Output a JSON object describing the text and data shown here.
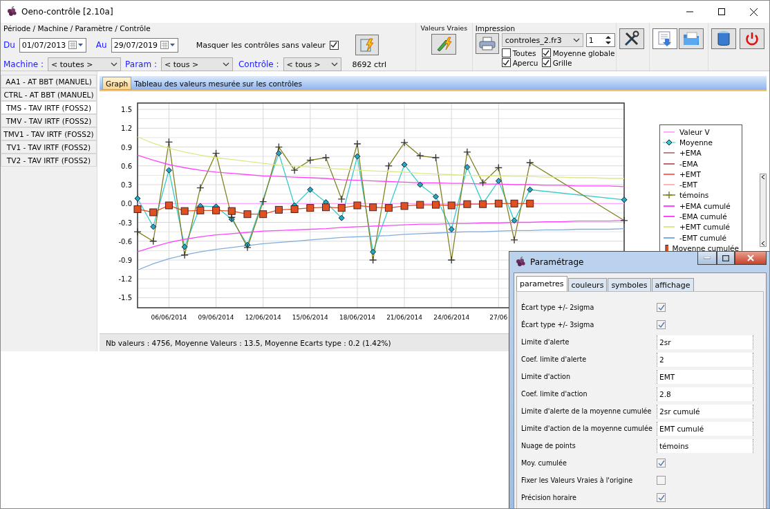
{
  "window": {
    "title": "Oeno-contrôle [2.10a]"
  },
  "filter_group": {
    "title": "Période / Machine / Paramètre / Contrôle",
    "from_label": "Du",
    "from_date": "01/07/2013",
    "to_label": "Au",
    "to_date": "29/07/2019",
    "hide_empty_label": "Masquer les contrôles sans valeur",
    "hide_empty_checked": true,
    "machine_label": "Machine :",
    "machine_value": "< toutes >",
    "param_label": "Param :",
    "param_value": "< tous >",
    "control_label": "Contrôle :",
    "control_value": "< tous >",
    "count": "8692 ctrl"
  },
  "true_values": {
    "title": "Valeurs Vraies"
  },
  "printing": {
    "title": "Impression",
    "template": "controles_2.fr3",
    "copies": "1",
    "options": [
      {
        "label": "Toutes",
        "checked": false
      },
      {
        "label": "Moyenne globale",
        "checked": true
      },
      {
        "label": "Apercu",
        "checked": true
      },
      {
        "label": "Grille",
        "checked": true
      }
    ]
  },
  "sidebar": {
    "items": [
      {
        "label": "AA1 - AT BBT (MANUEL)",
        "selected": false
      },
      {
        "label": "CTRL - AT BBT (MANUEL)",
        "selected": false
      },
      {
        "label": "TMS - TAV IRTF (FOSS2)",
        "selected": true
      },
      {
        "label": "TMV - TAV IRTF (FOSS2)",
        "selected": false
      },
      {
        "label": "TMV1 - TAV IRTF (FOSS2)",
        "selected": false
      },
      {
        "label": "TV1 - TAV IRTF (FOSS2)",
        "selected": false
      },
      {
        "label": "TV2 - TAV IRTF (FOSS2)",
        "selected": false
      }
    ]
  },
  "tabs": [
    {
      "label": "Graph",
      "selected": true
    },
    {
      "label": "Tableau des valeurs mesurée sur les contrôles",
      "selected": false
    }
  ],
  "chart": {
    "chart_data": {
      "type": "line",
      "grid": true,
      "categories": [
        null,
        null,
        "06/06/2014",
        null,
        null,
        "09/06/2014",
        null,
        null,
        "12/06/2014",
        null,
        null,
        "15/06/2014",
        null,
        null,
        "18/06/2014",
        null,
        null,
        "21/06/2014",
        null,
        null,
        "24/06/2014",
        null,
        null,
        "27/06",
        null,
        null,
        null,
        null,
        null,
        null,
        null,
        null
      ],
      "ylim": [
        -1.66,
        1.6
      ],
      "yticks": [
        {
          "value": 1.5,
          "label": "1.5"
        },
        {
          "value": 1.2,
          "label": "1.2"
        },
        {
          "value": 0.9,
          "label": "0.9"
        },
        {
          "value": 0.6,
          "label": "0.6"
        },
        {
          "value": 0.3,
          "label": "0.3"
        },
        {
          "value": 0,
          "label": "0.0"
        },
        {
          "value": -0.3,
          "label": "-0.3"
        },
        {
          "value": -0.6,
          "label": "-0.6"
        },
        {
          "value": -0.9,
          "label": "-0.9"
        },
        {
          "value": -1.2,
          "label": "-1.2"
        },
        {
          "value": -1.5,
          "label": "-1.5"
        }
      ],
      "series": [
        {
          "name": "Valeur V",
          "color": "#ffaaff",
          "marker": "none",
          "values": [
            0,
            0,
            0,
            0,
            0,
            0,
            0,
            0,
            0,
            0,
            0,
            0,
            0,
            0,
            0,
            0,
            0,
            0,
            0,
            0,
            0,
            0,
            0,
            0,
            0,
            0,
            0,
            0,
            0,
            0,
            0,
            0
          ]
        },
        {
          "name": "Moyenne",
          "color": "#33cccc",
          "marker": "diamond",
          "values": [
            0.08,
            -0.37,
            0.53,
            -0.69,
            -0.04,
            -0.05,
            -0.25,
            -0.66,
            null,
            0.8,
            -0.03,
            0.22,
            0.02,
            -0.23,
            0.75,
            -0.77,
            null,
            0.62,
            0.3,
            0.11,
            -0.41,
            0.58,
            0.0,
            0.36,
            -0.27,
            0.22,
            null,
            null,
            null,
            null,
            null,
            0.06
          ]
        },
        {
          "name": "+EMA",
          "color": "#b08888",
          "marker": "none",
          "values": [
            null,
            null,
            null,
            null,
            null,
            null,
            null,
            null,
            null,
            null,
            null,
            null,
            null,
            null,
            null,
            null,
            null,
            null,
            null,
            null,
            null,
            null,
            null,
            null,
            null,
            null,
            null,
            null,
            null,
            null,
            null,
            null
          ]
        },
        {
          "name": "-EMA",
          "color": "#c06868",
          "marker": "none",
          "values": [
            null,
            null,
            null,
            null,
            null,
            null,
            null,
            null,
            null,
            null,
            null,
            null,
            null,
            null,
            null,
            null,
            null,
            null,
            null,
            null,
            null,
            null,
            null,
            null,
            null,
            null,
            null,
            null,
            null,
            null,
            null,
            null
          ]
        },
        {
          "name": "+EMT",
          "color": "#ff6666",
          "marker": "none",
          "values": [
            null,
            null,
            null,
            null,
            null,
            null,
            null,
            null,
            null,
            null,
            null,
            null,
            null,
            null,
            null,
            null,
            null,
            null,
            null,
            null,
            null,
            null,
            null,
            null,
            null,
            null,
            null,
            null,
            null,
            null,
            null,
            null
          ]
        },
        {
          "name": "-EMT",
          "color": "#ffb4b4",
          "marker": "none",
          "values": [
            null,
            null,
            null,
            null,
            null,
            null,
            null,
            null,
            null,
            null,
            null,
            null,
            null,
            null,
            null,
            null,
            null,
            null,
            null,
            null,
            null,
            null,
            null,
            null,
            null,
            null,
            null,
            null,
            null,
            null,
            null,
            null
          ]
        },
        {
          "name": "témoins",
          "color": "#808020",
          "marker": "cross",
          "values": [
            -0.45,
            -0.6,
            0.98,
            -0.82,
            0.25,
            0.8,
            -0.22,
            -0.7,
            0.03,
            0.9,
            0.53,
            0.69,
            0.73,
            0.07,
            0.95,
            -0.9,
            0.6,
            0.97,
            0.76,
            0.73,
            -0.9,
            0.82,
            0.33,
            0.57,
            -0.58,
            0.65,
            null,
            null,
            null,
            null,
            null,
            -0.27
          ]
        },
        {
          "name": "+EMA cumulé",
          "color": "#ff44ff",
          "marker": "none",
          "values": [
            0.77,
            0.69,
            0.62,
            0.57,
            0.53,
            0.5,
            0.48,
            0.46,
            0.44,
            0.43,
            0.42,
            0.41,
            0.4,
            0.38,
            0.37,
            0.36,
            0.35,
            0.34,
            0.33,
            0.33,
            0.32,
            0.32,
            0.31,
            0.31,
            0.3,
            0.3,
            0.29,
            0.29,
            0.28,
            0.28,
            0.28,
            0.27
          ]
        },
        {
          "name": "-EMA cumulé",
          "color": "#ff44ff",
          "marker": "none",
          "values": [
            -0.77,
            -0.69,
            -0.62,
            -0.57,
            -0.53,
            -0.5,
            -0.48,
            -0.46,
            -0.44,
            -0.43,
            -0.42,
            -0.41,
            -0.4,
            -0.38,
            -0.37,
            -0.36,
            -0.35,
            -0.34,
            -0.33,
            -0.33,
            -0.32,
            -0.32,
            -0.31,
            -0.31,
            -0.3,
            -0.3,
            -0.29,
            -0.29,
            -0.28,
            -0.28,
            -0.28,
            -0.27
          ]
        },
        {
          "name": "+EMT cumulé",
          "color": "#dde888",
          "marker": "none",
          "values": [
            1.06,
            0.96,
            0.88,
            0.82,
            0.77,
            0.73,
            0.7,
            0.67,
            0.64,
            0.61,
            0.6,
            0.58,
            0.56,
            0.55,
            0.53,
            0.52,
            0.51,
            0.5,
            0.48,
            0.47,
            0.46,
            0.45,
            0.44,
            0.44,
            0.43,
            0.43,
            0.42,
            0.42,
            0.41,
            0.41,
            0.4,
            0.4
          ]
        },
        {
          "name": "-EMT cumulé",
          "color": "#80acdf",
          "marker": "none",
          "values": [
            -1.06,
            -0.96,
            -0.88,
            -0.82,
            -0.77,
            -0.73,
            -0.7,
            -0.67,
            -0.64,
            -0.62,
            -0.6,
            -0.58,
            -0.56,
            -0.54,
            -0.53,
            -0.52,
            -0.51,
            -0.49,
            -0.48,
            -0.47,
            -0.46,
            -0.45,
            -0.45,
            -0.44,
            -0.43,
            -0.43,
            -0.42,
            -0.42,
            -0.41,
            -0.41,
            -0.41,
            -0.4
          ]
        },
        {
          "name": "Moyenne cumulée",
          "color": "#e05020",
          "marker": "square",
          "values": [
            -0.09,
            -0.14,
            -0.03,
            -0.12,
            -0.11,
            -0.11,
            -0.12,
            -0.17,
            -0.17,
            -0.1,
            -0.09,
            -0.07,
            -0.06,
            -0.07,
            -0.03,
            -0.06,
            -0.07,
            -0.04,
            -0.02,
            -0.02,
            -0.03,
            -0.01,
            -0.01,
            0.0,
            0.0,
            0.0,
            null,
            null,
            null,
            null,
            null,
            null
          ]
        }
      ]
    }
  },
  "status_bar": "Nb valeurs : 4756, Moyenne Valeurs : 13.5, Moyenne Ecarts type : 0.2 (1.42%)",
  "dialog": {
    "title": "Paramétrage",
    "tabs": [
      {
        "label": "parametres",
        "selected": true
      },
      {
        "label": "couleurs",
        "selected": false
      },
      {
        "label": "symboles",
        "selected": false
      },
      {
        "label": "affichage",
        "selected": false
      }
    ],
    "rows": [
      {
        "label": "Écart type +/- 2sigma",
        "kind": "checkbox",
        "checked": true
      },
      {
        "label": "Écart type +/- 3sigma",
        "kind": "checkbox",
        "checked": true
      },
      {
        "label": "Limite d'alerte",
        "kind": "text",
        "value": "2sr"
      },
      {
        "label": "Coef. limite d'alerte",
        "kind": "text",
        "value": "2"
      },
      {
        "label": "Limite d'action",
        "kind": "text",
        "value": "EMT"
      },
      {
        "label": "Coef. limite d'action",
        "kind": "text",
        "value": "2.8"
      },
      {
        "label": "Limite d'alerte de la moyenne cumulée",
        "kind": "text",
        "value": "2sr cumulé"
      },
      {
        "label": "Limite d'action de la moyenne cumulée",
        "kind": "text",
        "value": "EMT cumulé"
      },
      {
        "label": "Nuage de points",
        "kind": "text",
        "value": "témoins"
      },
      {
        "label": "Moy. cumulée",
        "kind": "checkbox",
        "checked": true
      },
      {
        "label": "Fixer les Valeurs Vraies à l'origine",
        "kind": "checkbox",
        "checked": false
      },
      {
        "label": "Précision horaire",
        "kind": "checkbox",
        "checked": true
      }
    ]
  }
}
